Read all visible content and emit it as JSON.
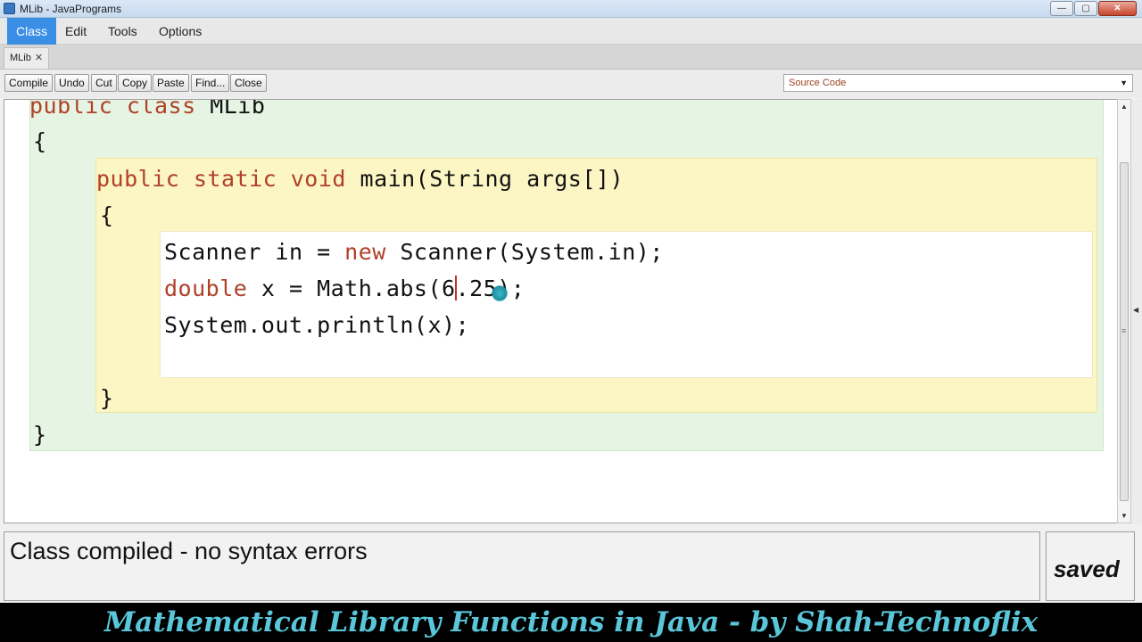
{
  "window": {
    "title": "MLib - JavaPrograms"
  },
  "window_buttons": {
    "minimize": "—",
    "maximize": "▢",
    "close": "✕"
  },
  "menu": {
    "items": [
      "Class",
      "Edit",
      "Tools",
      "Options"
    ],
    "active": "Class"
  },
  "tabs": [
    {
      "label": "MLib",
      "close": "✕"
    }
  ],
  "toolbar": {
    "buttons": [
      "Compile",
      "Undo",
      "Cut",
      "Copy",
      "Paste",
      "Find...",
      "Close"
    ],
    "view_select": "Source Code"
  },
  "code": {
    "class_decl": {
      "kw1": "public",
      "kw2": "class",
      "name": "MLib"
    },
    "class_open": "{",
    "method_decl": {
      "kw1": "public",
      "kw2": "static",
      "kw3": "void",
      "rest": "main(String args[])"
    },
    "method_open": "{",
    "line1": {
      "pre": "Scanner in = ",
      "kw": "new",
      "post": " Scanner(System.in);"
    },
    "line2": {
      "kw": "double",
      "pre": " x = Math.abs(6",
      "post": ".25);"
    },
    "line3": "System.out.println(x);",
    "method_close": "}",
    "class_close": "}"
  },
  "status": {
    "message": "Class compiled - no syntax errors",
    "saved": "saved"
  },
  "caption": "Mathematical Library Functions in Java - by Shah-Technoflix"
}
